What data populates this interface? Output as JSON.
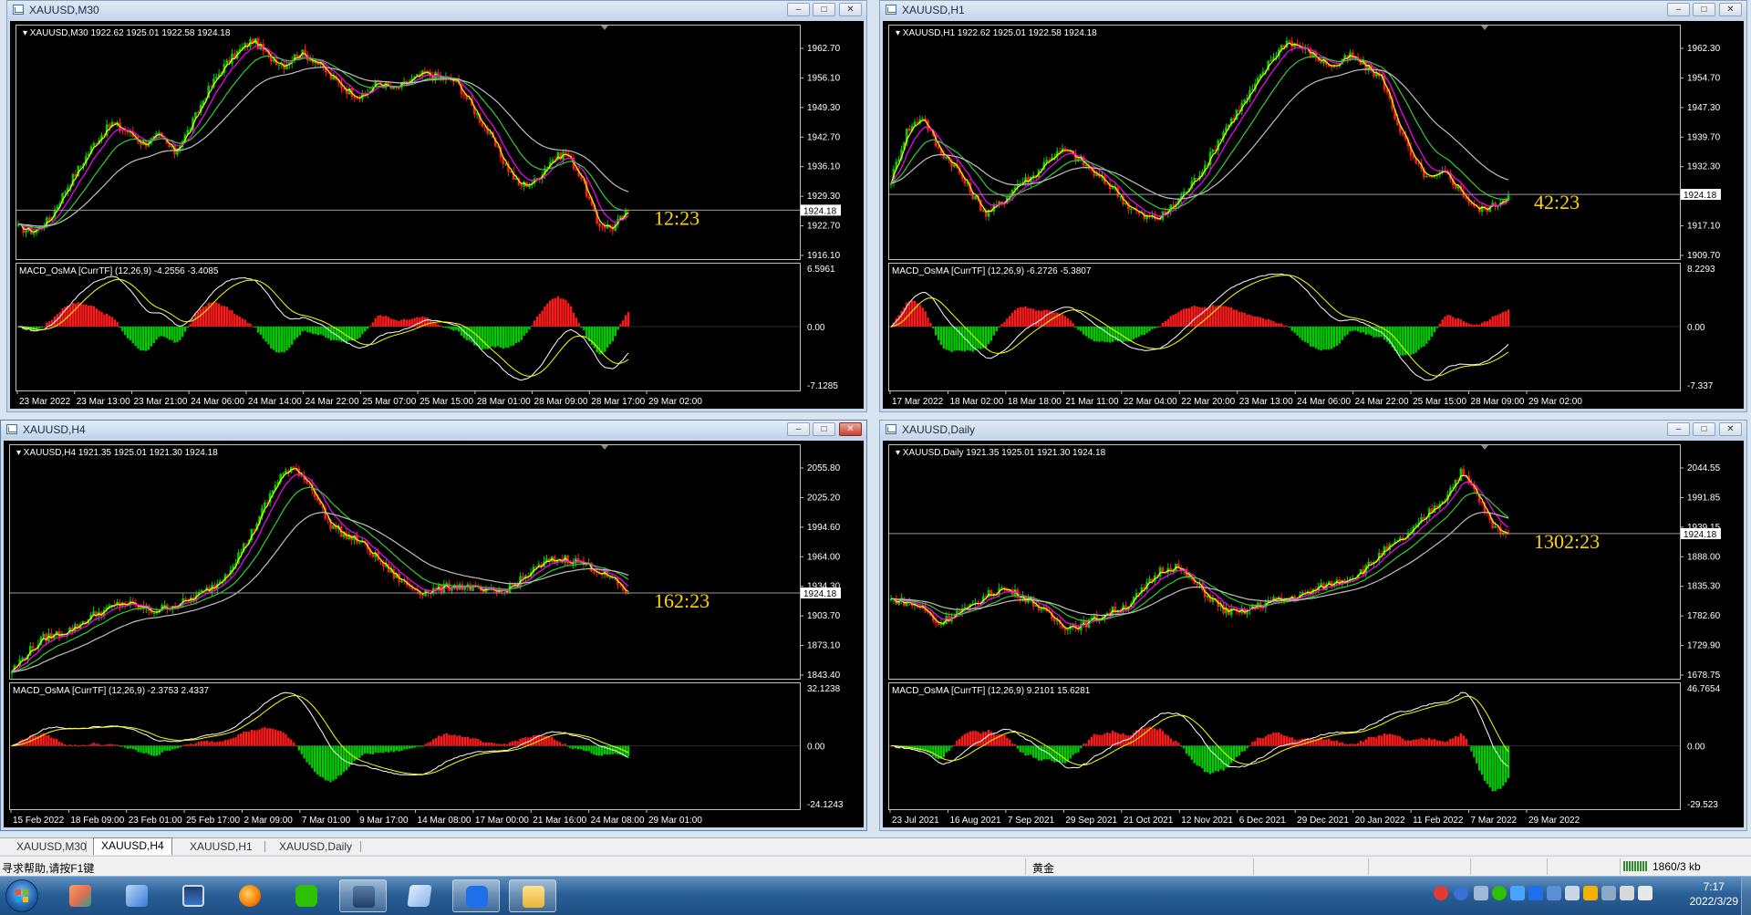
{
  "windows": [
    {
      "id": "m30",
      "title": "XAUUSD,M30",
      "active": false,
      "info": "XAUUSD,M30  1922.62 1925.01 1922.58 1924.18",
      "price_labels": [
        "1962.70",
        "1956.10",
        "1949.30",
        "1942.70",
        "1936.10",
        "1929.30",
        "1922.70",
        "1916.10"
      ],
      "current_price": "1924.18",
      "countdown": "12:23",
      "macd_info": "MACD_OsMA [CurrTF] (12,26,9) -4.2556 -3.4085",
      "macd_labels": [
        "6.5961",
        "0.00",
        "-7.1285"
      ],
      "time_labels": [
        "23 Mar 2022",
        "23 Mar 13:00",
        "23 Mar 21:00",
        "24 Mar 06:00",
        "24 Mar 14:00",
        "24 Mar 22:00",
        "25 Mar 07:00",
        "25 Mar 15:00",
        "28 Mar 01:00",
        "28 Mar 09:00",
        "28 Mar 17:00",
        "29 Mar 02:00"
      ]
    },
    {
      "id": "h1",
      "title": "XAUUSD,H1",
      "active": false,
      "info": "XAUUSD,H1  1922.62 1925.01 1922.58 1924.18",
      "price_labels": [
        "1962.30",
        "1954.70",
        "1947.30",
        "1939.70",
        "1932.30",
        "1924.18",
        "1917.10",
        "1909.70"
      ],
      "current_price": "1924.18",
      "countdown": "42:23",
      "macd_info": "MACD_OsMA [CurrTF] (12,26,9) -6.2726 -5.3807",
      "macd_labels": [
        "8.2293",
        "0.00",
        "-7.337"
      ],
      "time_labels": [
        "17 Mar 2022",
        "18 Mar 02:00",
        "18 Mar 18:00",
        "21 Mar 11:00",
        "22 Mar 04:00",
        "22 Mar 20:00",
        "23 Mar 13:00",
        "24 Mar 06:00",
        "24 Mar 22:00",
        "25 Mar 15:00",
        "28 Mar 09:00",
        "29 Mar 02:00"
      ]
    },
    {
      "id": "h4",
      "title": "XAUUSD,H4",
      "active": true,
      "info": "XAUUSD,H4  1921.35 1925.01 1921.30 1924.18",
      "price_labels": [
        "2055.80",
        "2025.20",
        "1994.60",
        "1964.00",
        "1934.30",
        "1903.70",
        "1873.10",
        "1843.40"
      ],
      "current_price": "1924.18",
      "countdown": "162:23",
      "macd_info": "MACD_OsMA [CurrTF] (12,26,9) -2.3753 2.4337",
      "macd_labels": [
        "32.1238",
        "0.00",
        "-24.1243"
      ],
      "time_labels": [
        "15 Feb 2022",
        "18 Feb 09:00",
        "23 Feb 01:00",
        "25 Feb 17:00",
        "2 Mar 09:00",
        "7 Mar 01:00",
        "9 Mar 17:00",
        "14 Mar 08:00",
        "17 Mar 00:00",
        "21 Mar 16:00",
        "24 Mar 08:00",
        "29 Mar 01:00"
      ]
    },
    {
      "id": "daily",
      "title": "XAUUSD,Daily",
      "active": false,
      "info": "XAUUSD,Daily  1921.35 1925.01 1921.30 1924.18",
      "price_labels": [
        "2044.55",
        "1991.85",
        "1939.15",
        "1888.00",
        "1835.30",
        "1782.60",
        "1729.90",
        "1678.75"
      ],
      "current_price": "1924.18",
      "countdown": "1302:23",
      "macd_info": "MACD_OsMA [CurrTF] (12,26,9) 9.2101 15.6281",
      "macd_labels": [
        "46.7654",
        "0.00",
        "-29.523"
      ],
      "time_labels": [
        "23 Jul 2021",
        "16 Aug 2021",
        "7 Sep 2021",
        "29 Sep 2021",
        "21 Oct 2021",
        "12 Nov 2021",
        "6 Dec 2021",
        "29 Dec 2021",
        "20 Jan 2022",
        "11 Feb 2022",
        "7 Mar 2022",
        "29 Mar 2022"
      ]
    }
  ],
  "window_buttons": {
    "minimize": "–",
    "maximize": "□",
    "close": "✕"
  },
  "tabs": [
    "XAUUSD,M30",
    "XAUUSD,H4",
    "XAUUSD,H1",
    "XAUUSD,Daily"
  ],
  "active_tab": 1,
  "status": {
    "help": "寻求帮助,请按F1键",
    "profile": "黄金",
    "traffic": "1860/3 kb"
  },
  "clock": {
    "time": "7:17",
    "date": "2022/3/29"
  },
  "colors": {
    "bull": "#00cc00",
    "bear": "#ff1a1a",
    "ma_yellow": "#ffff00",
    "ma_magenta": "#ff00ff",
    "ma_green": "#32cd32",
    "ma_silver": "#c0c0c0",
    "countdown": "#ffd700"
  },
  "chart_data": [
    {
      "window": "XAUUSD,M30",
      "type": "candlestick",
      "y_range": [
        1912.9,
        1966.0
      ],
      "close_path": [
        1920,
        1919,
        1922,
        1929,
        1935,
        1941,
        1945,
        1943,
        1940,
        1942,
        1938,
        1944,
        1952,
        1958,
        1962,
        1965,
        1961,
        1959,
        1962,
        1960,
        1956,
        1953,
        1951,
        1955,
        1953,
        1955,
        1957,
        1956,
        1955,
        1949,
        1943,
        1936,
        1930,
        1931,
        1936,
        1938,
        1932,
        1921,
        1920,
        1924
      ]
    },
    {
      "window": "XAUUSD,H1",
      "type": "candlestick",
      "y_range": [
        1907.5,
        1966.3
      ],
      "close_path": [
        1928,
        1941,
        1945,
        1936,
        1932,
        1925,
        1919,
        1922,
        1927,
        1929,
        1934,
        1936,
        1933,
        1929,
        1926,
        1921,
        1918,
        1918,
        1922,
        1927,
        1933,
        1941,
        1947,
        1953,
        1960,
        1965,
        1963,
        1960,
        1958,
        1961,
        1958,
        1955,
        1943,
        1933,
        1928,
        1930,
        1925,
        1920,
        1921,
        1924
      ]
    },
    {
      "window": "XAUUSD,H4",
      "type": "candlestick",
      "y_range": [
        1836.5,
        2068.1
      ],
      "close_path": [
        1843,
        1862,
        1877,
        1882,
        1888,
        1900,
        1907,
        1914,
        1910,
        1905,
        1911,
        1915,
        1924,
        1934,
        1955,
        1982,
        2015,
        2048,
        2054,
        2034,
        1998,
        1985,
        1978,
        1962,
        1945,
        1932,
        1925,
        1928,
        1932,
        1930,
        1924,
        1926,
        1935,
        1948,
        1958,
        1960,
        1956,
        1948,
        1938,
        1924
      ]
    },
    {
      "window": "XAUUSD,Daily",
      "type": "candlestick",
      "y_range": [
        1665.7,
        2065.6
      ],
      "close_path": [
        1805,
        1800,
        1790,
        1760,
        1780,
        1790,
        1812,
        1826,
        1815,
        1800,
        1775,
        1757,
        1758,
        1772,
        1785,
        1796,
        1825,
        1858,
        1866,
        1840,
        1812,
        1786,
        1780,
        1792,
        1802,
        1807,
        1813,
        1826,
        1836,
        1845,
        1862,
        1890,
        1908,
        1930,
        1963,
        1990,
        2035,
        1995,
        1936,
        1924
      ]
    }
  ]
}
